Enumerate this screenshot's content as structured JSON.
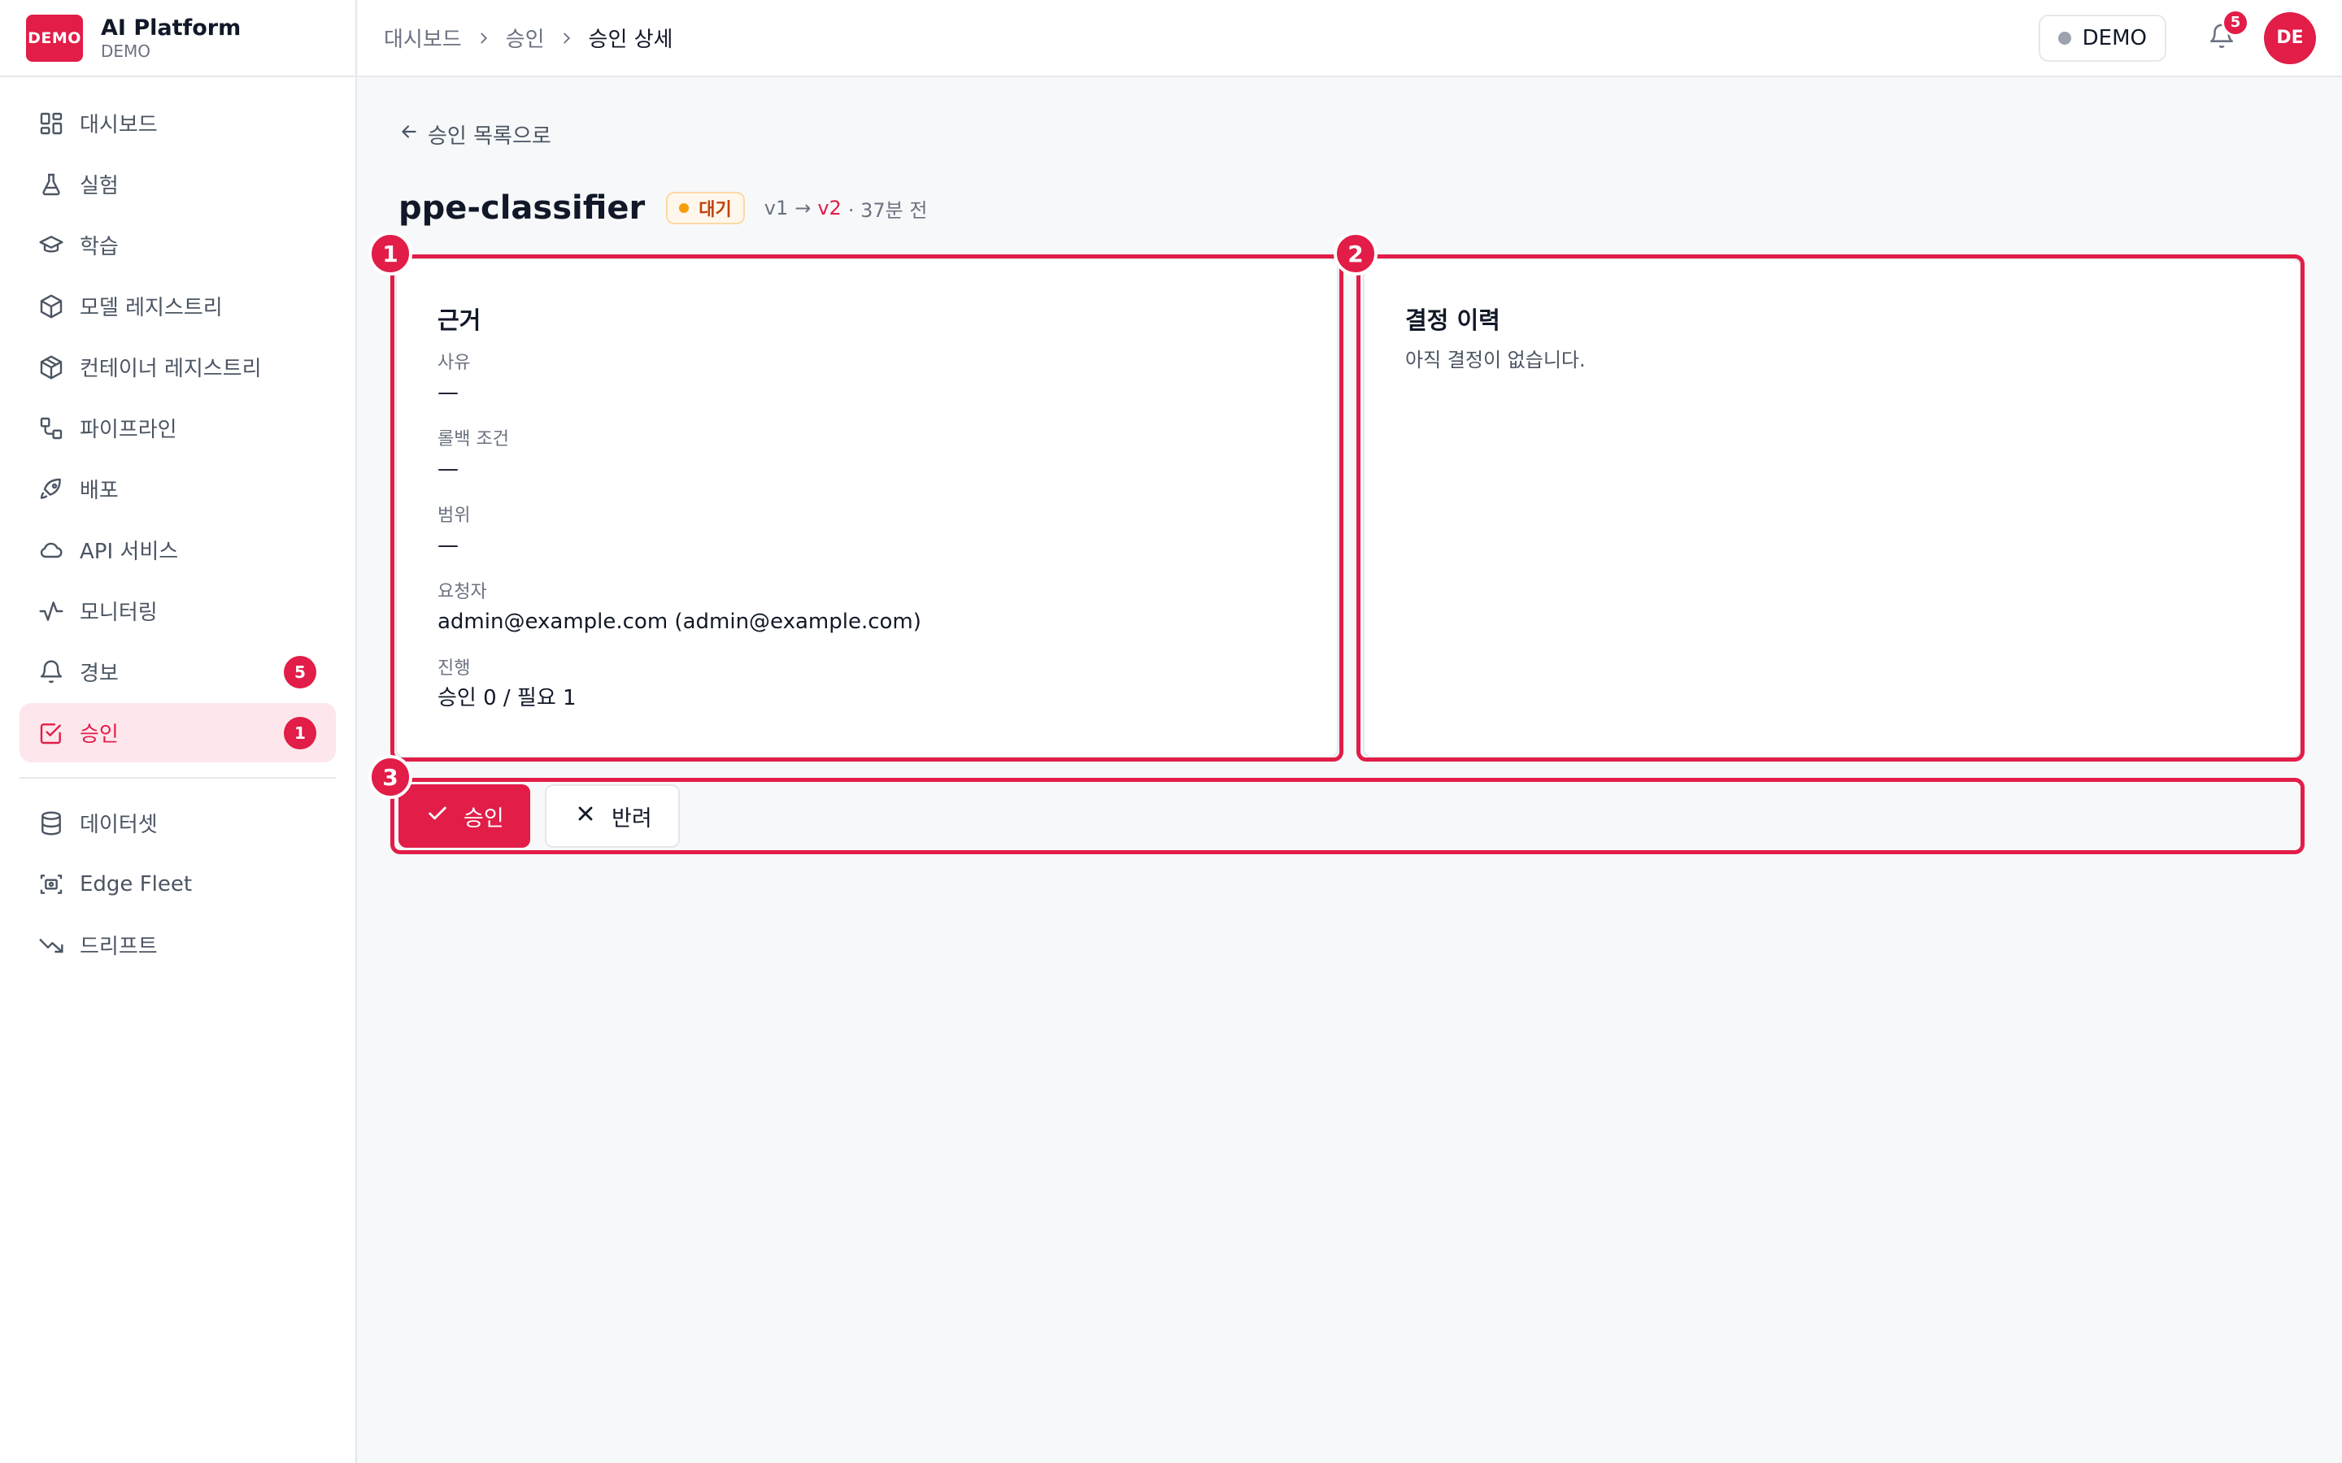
{
  "brand": {
    "logo": "DEMO",
    "title": "AI Platform",
    "subtitle": "DEMO"
  },
  "sidebar": {
    "items": [
      {
        "label": "대시보드",
        "icon": "dashboard-icon"
      },
      {
        "label": "실험",
        "icon": "flask-icon"
      },
      {
        "label": "학습",
        "icon": "graduation-cap-icon"
      },
      {
        "label": "모델 레지스트리",
        "icon": "cube-icon"
      },
      {
        "label": "컨테이너 레지스트리",
        "icon": "package-icon"
      },
      {
        "label": "파이프라인",
        "icon": "workflow-icon"
      },
      {
        "label": "배포",
        "icon": "rocket-icon"
      },
      {
        "label": "API 서비스",
        "icon": "cloud-icon"
      },
      {
        "label": "모니터링",
        "icon": "activity-icon"
      },
      {
        "label": "경보",
        "icon": "bell-icon",
        "badge": "5"
      },
      {
        "label": "승인",
        "icon": "check-square-icon",
        "badge": "1",
        "active": true
      }
    ],
    "items2": [
      {
        "label": "데이터셋",
        "icon": "database-icon"
      },
      {
        "label": "Edge Fleet",
        "icon": "edge-device-icon"
      },
      {
        "label": "드리프트",
        "icon": "trending-down-icon"
      }
    ]
  },
  "topbar": {
    "breadcrumb": [
      "대시보드",
      "승인",
      "승인 상세"
    ],
    "env": "DEMO",
    "notifications": "5",
    "avatar": "DE"
  },
  "page": {
    "back": "승인 목록으로",
    "title": "ppe-classifier",
    "status": "대기",
    "from_version": "v1",
    "arrow": "→",
    "to_version": "v2",
    "time": "· 37분 전"
  },
  "rationale": {
    "title": "근거",
    "fields": [
      {
        "label": "사유",
        "value": "—"
      },
      {
        "label": "롤백 조건",
        "value": "—"
      },
      {
        "label": "범위",
        "value": "—"
      },
      {
        "label": "요청자",
        "value": "admin@example.com (admin@example.com)"
      },
      {
        "label": "진행",
        "value": "승인 0 / 필요 1"
      }
    ]
  },
  "history": {
    "title": "결정 이력",
    "empty": "아직 결정이 없습니다."
  },
  "actions": {
    "approve": "승인",
    "reject": "반려"
  },
  "markers": [
    "1",
    "2",
    "3"
  ],
  "colors": {
    "accent": "#e11d48",
    "pending": "#f59e0b"
  }
}
